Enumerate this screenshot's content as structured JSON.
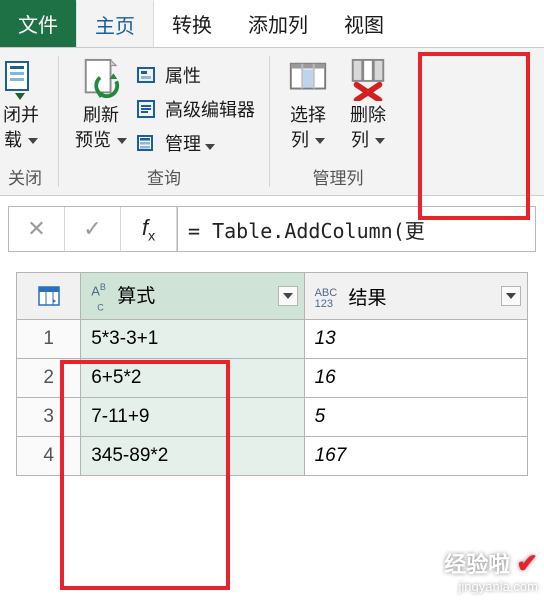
{
  "menu": {
    "file": "文件",
    "home": "主页",
    "transform": "转换",
    "addcol": "添加列",
    "view": "视图"
  },
  "ribbon": {
    "closeload_top": "闭并",
    "closeload_bot": "载",
    "refresh_top": "刷新",
    "refresh_bot": "预览",
    "properties": "属性",
    "adv_editor": "高级编辑器",
    "manage": "管理",
    "select_cols_top": "选择",
    "select_cols_bot": "列",
    "remove_cols_top": "删除",
    "remove_cols_bot": "列",
    "group_query": "查询",
    "group_cols": "管理列"
  },
  "group_close": "关闭",
  "formula": {
    "text": "= Table.AddColumn(更"
  },
  "table": {
    "col1": "算式",
    "col2": "结果",
    "rows": [
      {
        "n": "1",
        "formula": "5*3-3+1",
        "result": "13"
      },
      {
        "n": "2",
        "formula": "6+5*2",
        "result": "16"
      },
      {
        "n": "3",
        "formula": "7-11+9",
        "result": "5"
      },
      {
        "n": "4",
        "formula": "345-89*2",
        "result": "167"
      }
    ]
  },
  "watermark": {
    "line1": "经验啦",
    "line2": "jingyanla.com"
  },
  "colors": {
    "highlight": "#e8232d",
    "accent": "#1e7145"
  }
}
